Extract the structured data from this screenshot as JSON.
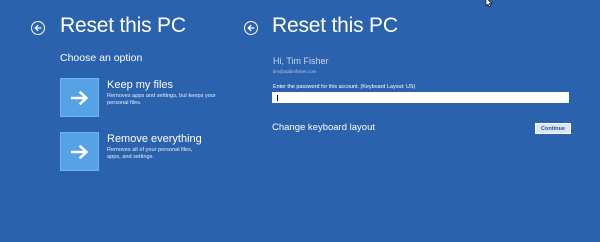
{
  "left_panel": {
    "title": "Reset this PC",
    "subtitle": "Choose an option",
    "options": [
      {
        "title": "Keep my files",
        "description": "Removes apps and settings, but keeps your personal files."
      },
      {
        "title": "Remove everything",
        "description": "Removes all of your personal files, apps, and settings."
      }
    ]
  },
  "right_panel": {
    "title": "Reset this PC",
    "greeting": "Hi, Tim Fisher",
    "email": "tim@addimfisher.com",
    "password_prompt": "Enter the password for this account. (Keyboard Layout: US)",
    "password_value": "",
    "change_keyboard_label": "Change keyboard layout",
    "continue_label": "Continue"
  },
  "colors": {
    "background": "#2b62ae",
    "tile": "#56a2e4",
    "text": "#ffffff"
  },
  "icons": {
    "back": "back-arrow-circle-icon",
    "option": "right-arrow-icon"
  }
}
